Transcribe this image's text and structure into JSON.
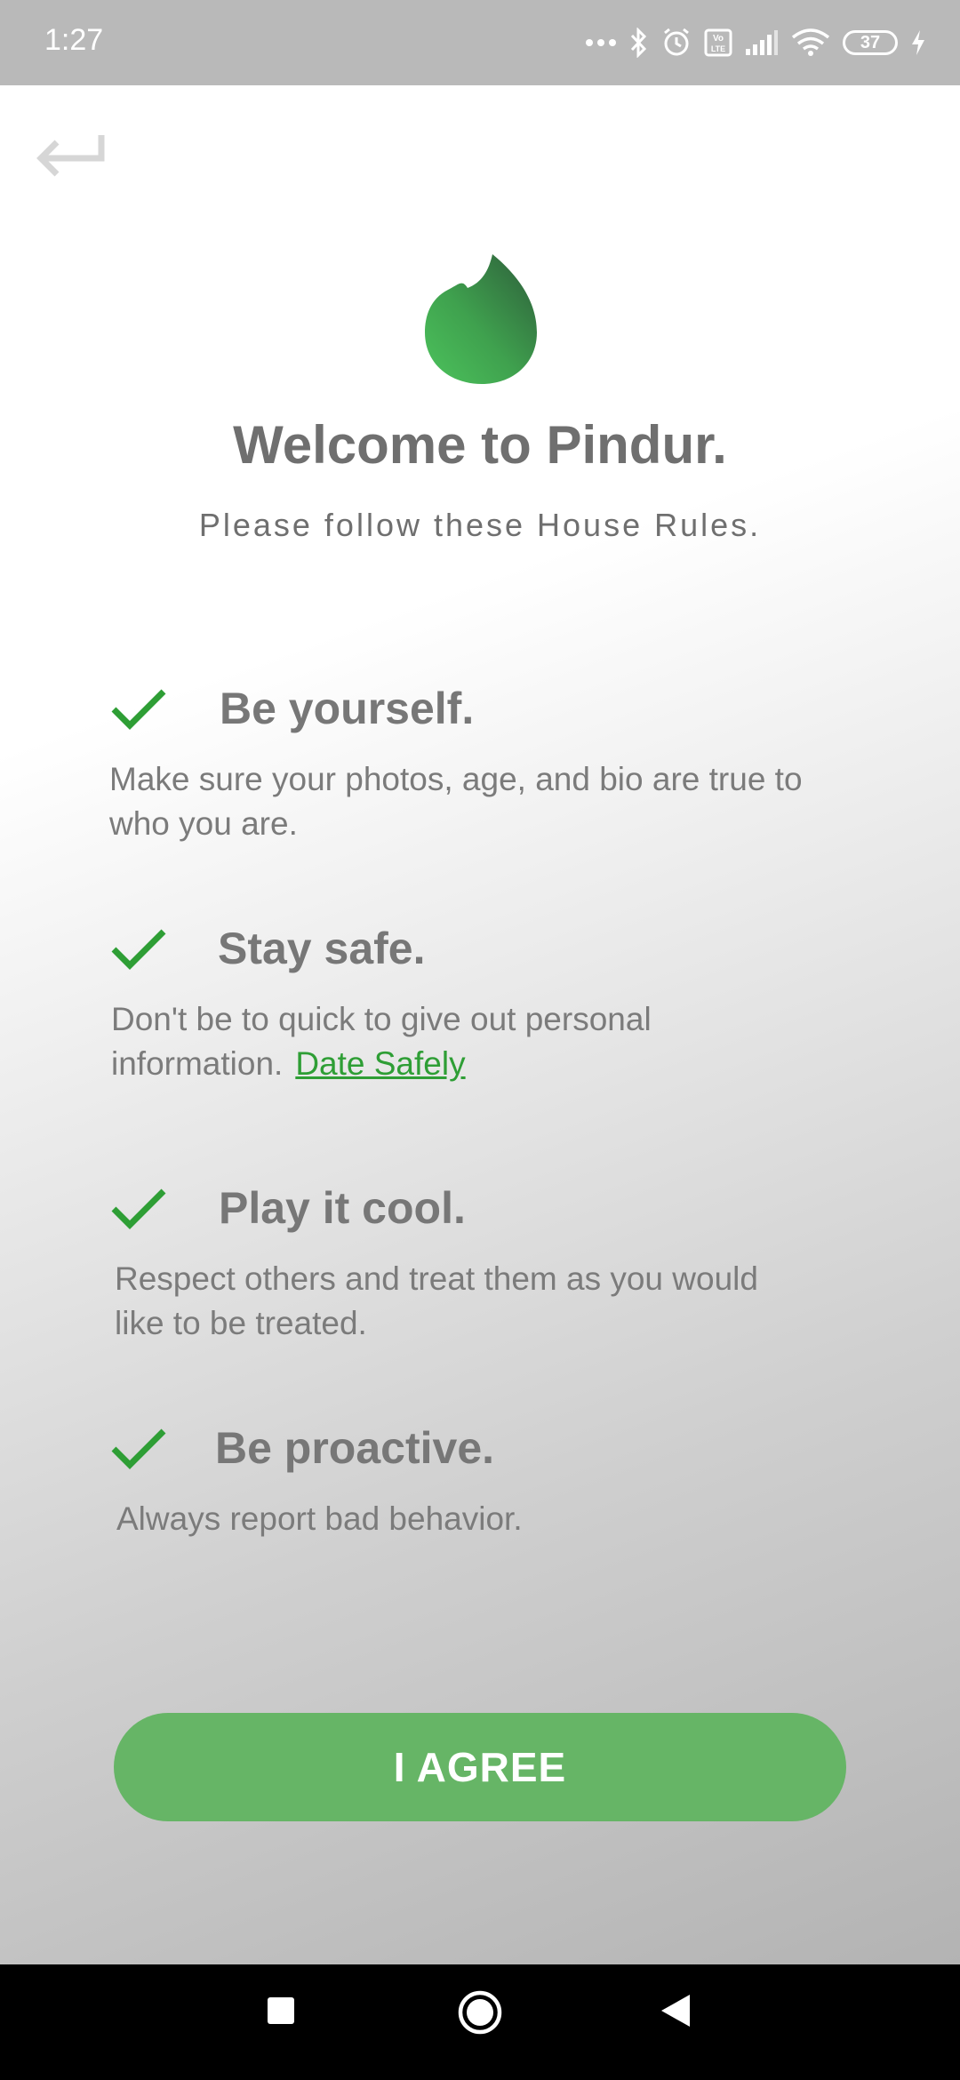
{
  "status_bar": {
    "time": "1:27",
    "battery_level": "37",
    "icons": [
      "more-dots-icon",
      "bluetooth-icon",
      "alarm-icon",
      "volte-icon",
      "signal-icon",
      "wifi-icon",
      "battery-icon",
      "charging-icon"
    ]
  },
  "header": {
    "back_icon": "back-arrow-icon"
  },
  "welcome": {
    "logo_icon": "flame-logo-icon",
    "title": "Welcome to Pindur.",
    "subtitle": "Please follow these House Rules."
  },
  "rules": [
    {
      "title": "Be yourself.",
      "description": "Make sure your photos, age, and bio are true to who you are."
    },
    {
      "title": "Stay safe.",
      "description": "Don't be to quick to give out personal information.",
      "link": "Date Safely"
    },
    {
      "title": "Play it cool.",
      "description": "Respect others and treat them as you would like to be treated."
    },
    {
      "title": "Be proactive.",
      "description": "Always report bad behavior."
    }
  ],
  "agree_button": {
    "label": "I AGREE"
  },
  "nav_bar": {
    "icons": [
      "recents-square-icon",
      "home-circle-icon",
      "back-triangle-icon"
    ]
  },
  "colors": {
    "accent_green": "#2e9e35",
    "button_green": "#66b566",
    "text_gray": "#6f6f6f",
    "status_bar": "#b9b9b9"
  }
}
